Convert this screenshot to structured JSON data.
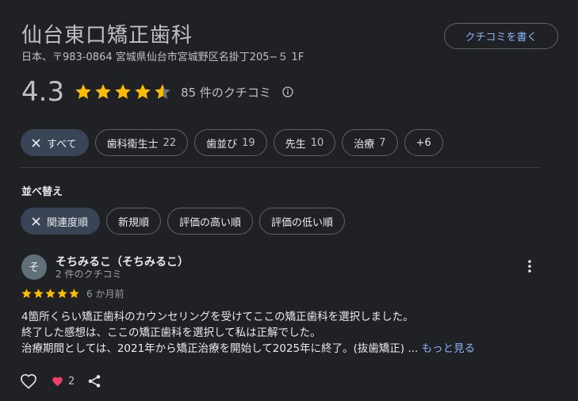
{
  "place": {
    "name": "仙台東口矯正歯科",
    "address": "日本、〒983-0864 宮城県仙台市宮城野区名掛丁205−５ 1F",
    "write_review_label": "クチコミを書く",
    "rating": "4.3",
    "rating_value": 4.3,
    "review_count_label": "85 件のクチコミ"
  },
  "topic_chips": [
    {
      "label": "すべて",
      "count": "",
      "selected": true
    },
    {
      "label": "歯科衛生士",
      "count": "22",
      "selected": false
    },
    {
      "label": "歯並び",
      "count": "19",
      "selected": false
    },
    {
      "label": "先生",
      "count": "10",
      "selected": false
    },
    {
      "label": "治療",
      "count": "7",
      "selected": false
    },
    {
      "label": "+6",
      "count": "",
      "selected": false
    }
  ],
  "sort": {
    "label": "並べ替え",
    "options": [
      {
        "label": "関連度順",
        "selected": true
      },
      {
        "label": "新規順",
        "selected": false
      },
      {
        "label": "評価の高い順",
        "selected": false
      },
      {
        "label": "評価の低い順",
        "selected": false
      }
    ]
  },
  "review": {
    "avatar_initial": "そ",
    "reviewer_name": "そちみるこ（そちみるこ）",
    "reviewer_meta": "2 件のクチコミ",
    "stars": 5,
    "date": "6 か月前",
    "lines": [
      "4箇所くらい矯正歯科のカウンセリングを受けてここの矯正歯科を選択しました。",
      "終了した感想は、ここの矯正歯科を選択して私は正解でした。",
      "治療期間としては、2021年から矯正治療を開始して2025年に終了。(抜歯矯正) ..."
    ],
    "more_label": "もっと見る",
    "reaction_count": "2"
  },
  "colors": {
    "background": "#202124",
    "star": "#fbbc04",
    "link": "#8ab4f8",
    "heart": "#f03e6b",
    "selected_chip": "#394457"
  }
}
